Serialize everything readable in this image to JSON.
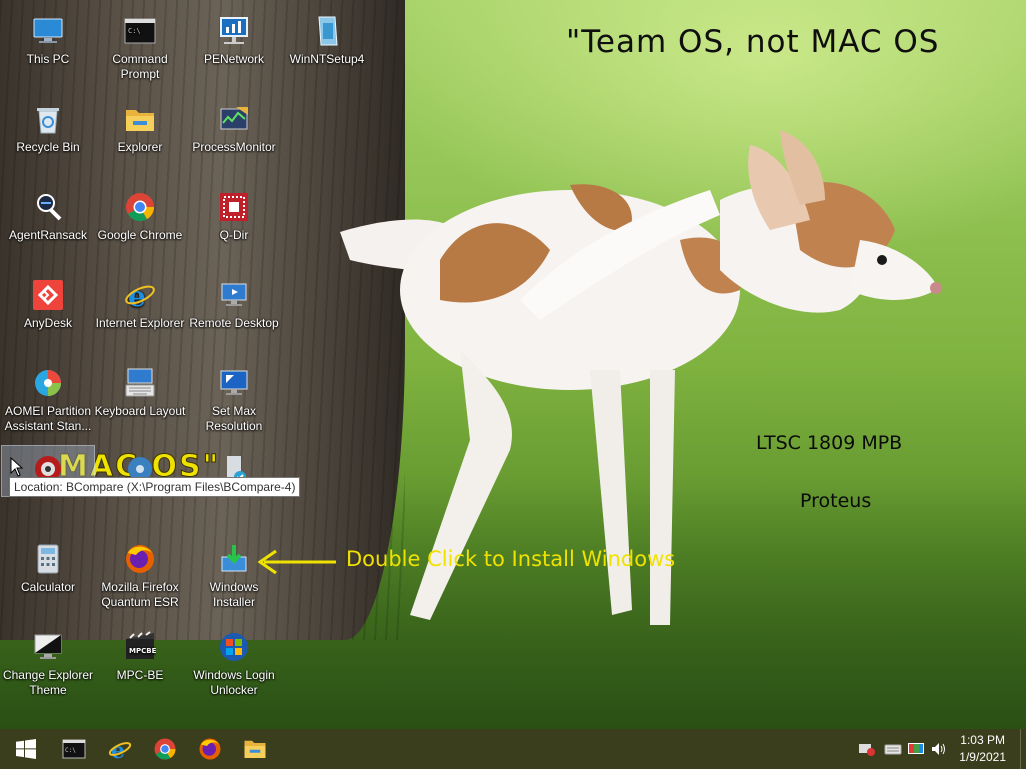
{
  "wallpaper": {
    "headline": "\"Team OS, not MAC OS",
    "macos_fragment": "MAC OS\"",
    "edition": "LTSC 1809 MPB",
    "author": "Proteus",
    "install_hint": "Double Click to Install Windows",
    "hint_color": "#f0e200"
  },
  "desktop_icons": [
    {
      "label": "This PC",
      "icon": "computer-icon"
    },
    {
      "label": "Command Prompt",
      "icon": "command-prompt-icon"
    },
    {
      "label": "PENetwork",
      "icon": "network-icon"
    },
    {
      "label": "WinNTSetup4",
      "icon": "setup-icon"
    },
    {
      "label": "Recycle Bin",
      "icon": "recycle-bin-icon"
    },
    {
      "label": "Explorer",
      "icon": "folder-icon"
    },
    {
      "label": "ProcessMonitor",
      "icon": "process-monitor-icon"
    },
    {
      "label": "AgentRansack",
      "icon": "agent-ransack-icon"
    },
    {
      "label": "Google Chrome",
      "icon": "chrome-icon"
    },
    {
      "label": "Q-Dir",
      "icon": "q-dir-icon"
    },
    {
      "label": "AnyDesk",
      "icon": "anydesk-icon"
    },
    {
      "label": "Internet Explorer",
      "icon": "internet-explorer-icon"
    },
    {
      "label": "Remote Desktop",
      "icon": "remote-desktop-icon"
    },
    {
      "label": "AOMEI Partition Assistant Stan...",
      "icon": "aomei-icon"
    },
    {
      "label": "Keyboard Layout",
      "icon": "keyboard-icon"
    },
    {
      "label": "Set Max Resolution",
      "icon": "display-icon"
    },
    {
      "label": "Calculator",
      "icon": "calculator-icon"
    },
    {
      "label": "Mozilla Firefox Quantum ESR",
      "icon": "firefox-icon"
    },
    {
      "label": "Windows Installer",
      "icon": "installer-icon"
    },
    {
      "label": "Change Explorer Theme",
      "icon": "theme-icon"
    },
    {
      "label": "MPC-BE",
      "icon": "mpc-be-icon"
    },
    {
      "label": "Windows Login Unlocker",
      "icon": "windows-logo-icon"
    }
  ],
  "tooltip": {
    "text": "Location: BCompare (X:\\Program Files\\BCompare-4)"
  },
  "taskbar": {
    "start": "windows-start-icon",
    "pinned": [
      "command-prompt-icon",
      "internet-explorer-icon",
      "chrome-icon",
      "firefox-icon",
      "folder-icon"
    ],
    "tray": [
      "network-icon",
      "keyboard-icon",
      "display-icon",
      "volume-icon"
    ],
    "time": "1:03 PM",
    "date": "1/9/2021",
    "color": "#3b3e1d"
  }
}
